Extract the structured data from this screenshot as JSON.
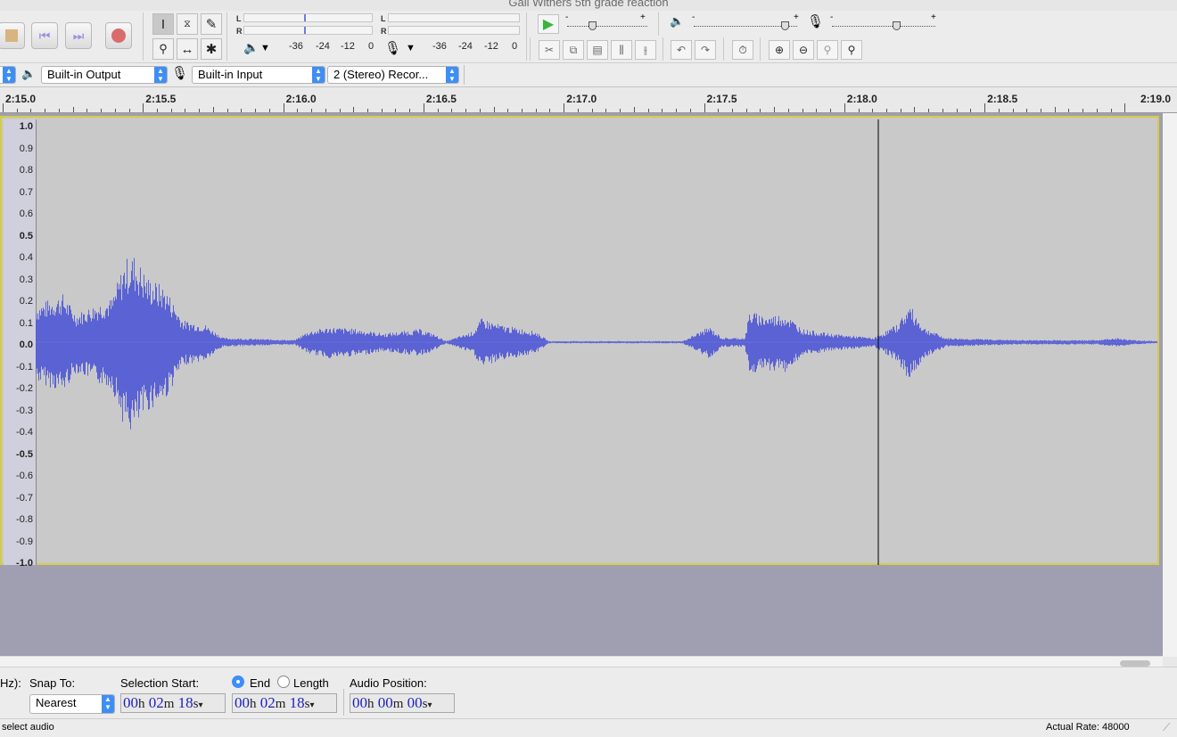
{
  "window": {
    "title": "Gail Withers 5th grade reaction"
  },
  "meters": {
    "playback_left": "L",
    "playback_right": "R",
    "record_left": "L",
    "record_right": "R",
    "playback_scale": [
      "-36",
      "-24",
      "-12",
      "0"
    ],
    "record_scale": [
      "-36",
      "-24",
      "-12",
      "0"
    ],
    "slider_minus": "-",
    "slider_plus": "+"
  },
  "device": {
    "output": "Built-in Output",
    "input": "Built-in Input",
    "channels": "2 (Stereo) Recor..."
  },
  "ruler": {
    "labels": [
      "2:15.0",
      "2:15.5",
      "2:16.0",
      "2:16.5",
      "2:17.0",
      "2:17.5",
      "2:18.0",
      "2:18.5",
      "2:19.0"
    ]
  },
  "track": {
    "amplitude_labels": [
      "1.0",
      "0.9",
      "0.8",
      "0.7",
      "0.6",
      "0.5",
      "0.4",
      "0.3",
      "0.2",
      "0.1",
      "0.0",
      "-0.1",
      "-0.2",
      "-0.3",
      "-0.4",
      "-0.5",
      "-0.6",
      "-0.7",
      "-0.8",
      "-0.9",
      "-1.0"
    ],
    "waveform_color": "#5a62d4"
  },
  "selection": {
    "rate_label": "Hz):",
    "snap_label": "Snap To:",
    "snap_value": "Nearest",
    "start_label": "Selection Start:",
    "end_label": "End",
    "length_label": "Length",
    "position_label": "Audio Position:",
    "start_time": {
      "h": "00",
      "m": "02",
      "s": "18"
    },
    "end_time": {
      "h": "00",
      "m": "02",
      "s": "18"
    },
    "position_time": {
      "h": "00",
      "m": "00",
      "s": "00"
    },
    "unit_h": "h",
    "unit_m": "m",
    "unit_s": "s"
  },
  "status": {
    "left": "select audio",
    "right": "Actual Rate: 48000"
  }
}
